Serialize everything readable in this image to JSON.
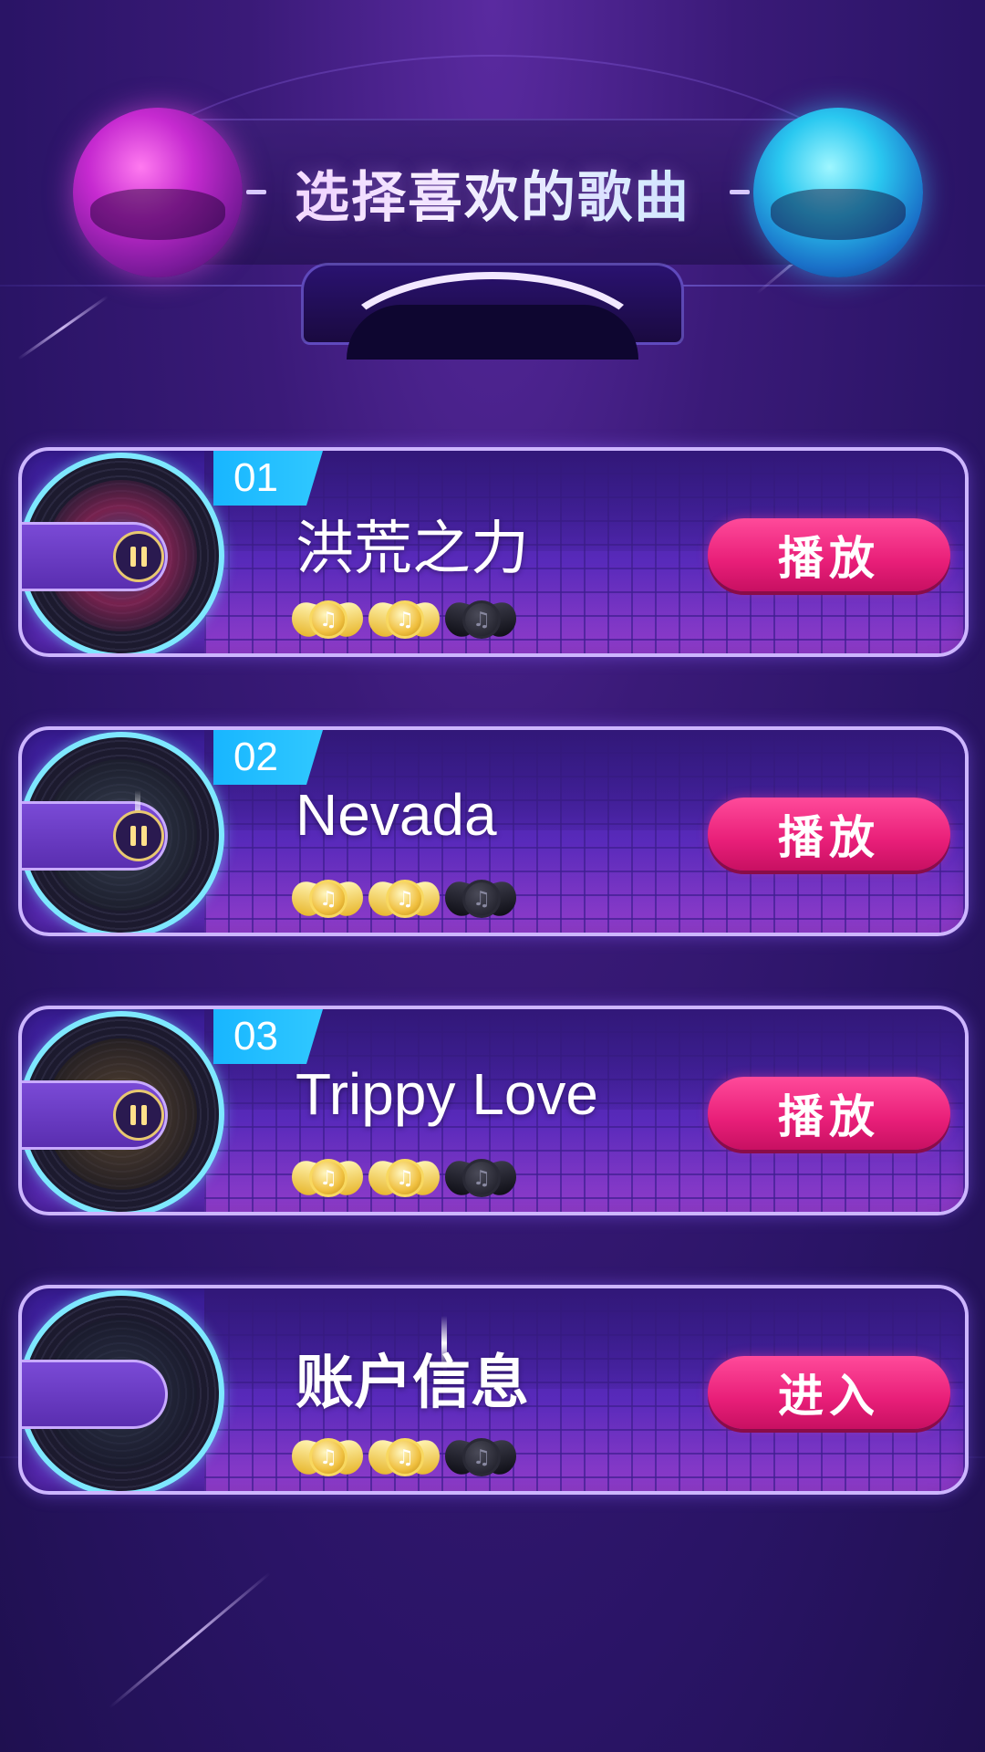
{
  "header": {
    "title": "选择喜欢的歌曲"
  },
  "songs": [
    {
      "number": "01",
      "title": "洪荒之力",
      "button_label": "播放",
      "medals_earned": 2,
      "medals_total": 3,
      "accent": "#d02868"
    },
    {
      "number": "02",
      "title": "Nevada",
      "button_label": "播放",
      "medals_earned": 2,
      "medals_total": 3,
      "accent": "#2a3a48"
    },
    {
      "number": "03",
      "title": "Trippy Love",
      "button_label": "播放",
      "medals_earned": 2,
      "medals_total": 3,
      "accent": "#6a4a20"
    }
  ],
  "account": {
    "title": "账户信息",
    "button_label": "进入",
    "medals_earned": 2,
    "medals_total": 3
  },
  "colors": {
    "background": "#2a1466",
    "button_pink": "#e81e78",
    "badge_blue": "#18b6ff",
    "disc_ring": "#7ee8ff",
    "orb_left": "#c62ad0",
    "orb_right": "#2ac8f0"
  },
  "icons": {
    "pause": "pause-icon",
    "medal_gold": "gold-winged-music-medal-icon",
    "medal_locked": "dark-winged-music-medal-icon"
  }
}
